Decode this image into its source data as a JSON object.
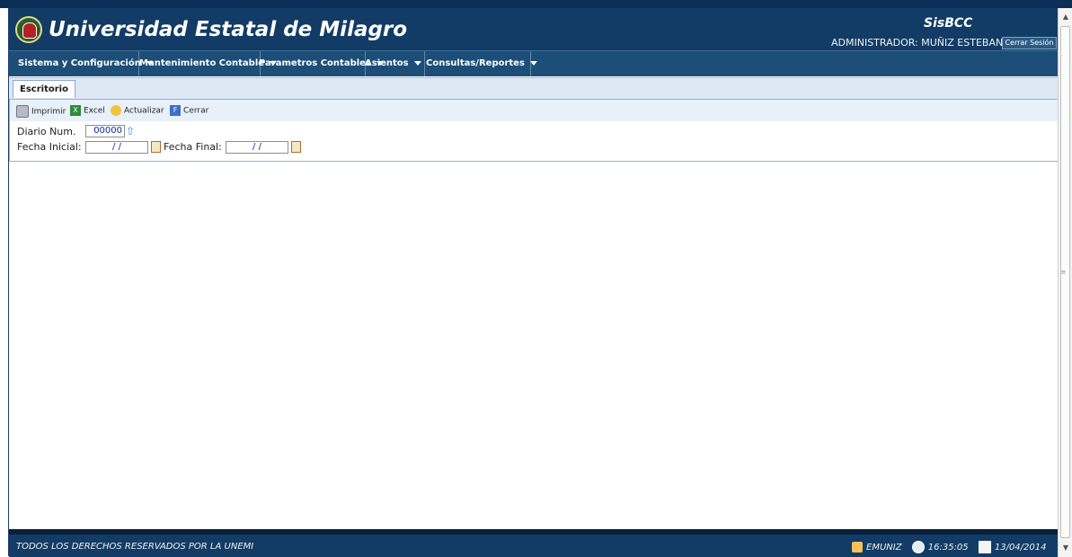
{
  "header": {
    "title": "Universidad Estatal de Milagro",
    "app_name": "SisBCC",
    "user": "ADMINISTRADOR: MUÑIZ ESTEBAN",
    "logout_label": "Cerrar Sesión"
  },
  "menu": [
    {
      "label": "Sistema y Configuración"
    },
    {
      "label": "Mantenimiento Contable"
    },
    {
      "label": "Parametros Contables"
    },
    {
      "label": "Asientos"
    },
    {
      "label": "Consultas/Reportes"
    }
  ],
  "tabs": [
    {
      "label": "Escritorio"
    }
  ],
  "toolbar": {
    "print": "Imprimir",
    "excel": "Excel",
    "refresh": "Actualizar",
    "close": "Cerrar"
  },
  "form": {
    "diario_label": "Diario Num.",
    "diario_value": "00000",
    "fecha_inicial_label": "Fecha Inicial:",
    "fecha_inicial_value": "/ /",
    "fecha_final_label": "Fecha Final:",
    "fecha_final_value": "/ /"
  },
  "footer": {
    "rights": "TODOS LOS DERECHOS RESERVADOS POR LA UNEMI",
    "username": "EMUNIZ",
    "time": "16:35:05",
    "date": "13/04/2014"
  },
  "colors": {
    "header_bg": "#123c65",
    "menu_bg": "#1d4e78",
    "tab_bg": "#dde8f5",
    "toolbar_bg": "#e8f0fa"
  },
  "icons": [
    "print-icon",
    "excel-icon",
    "refresh-icon",
    "close-icon",
    "arrow-up-icon",
    "calendar-icon",
    "user-icon",
    "clock-icon"
  ]
}
